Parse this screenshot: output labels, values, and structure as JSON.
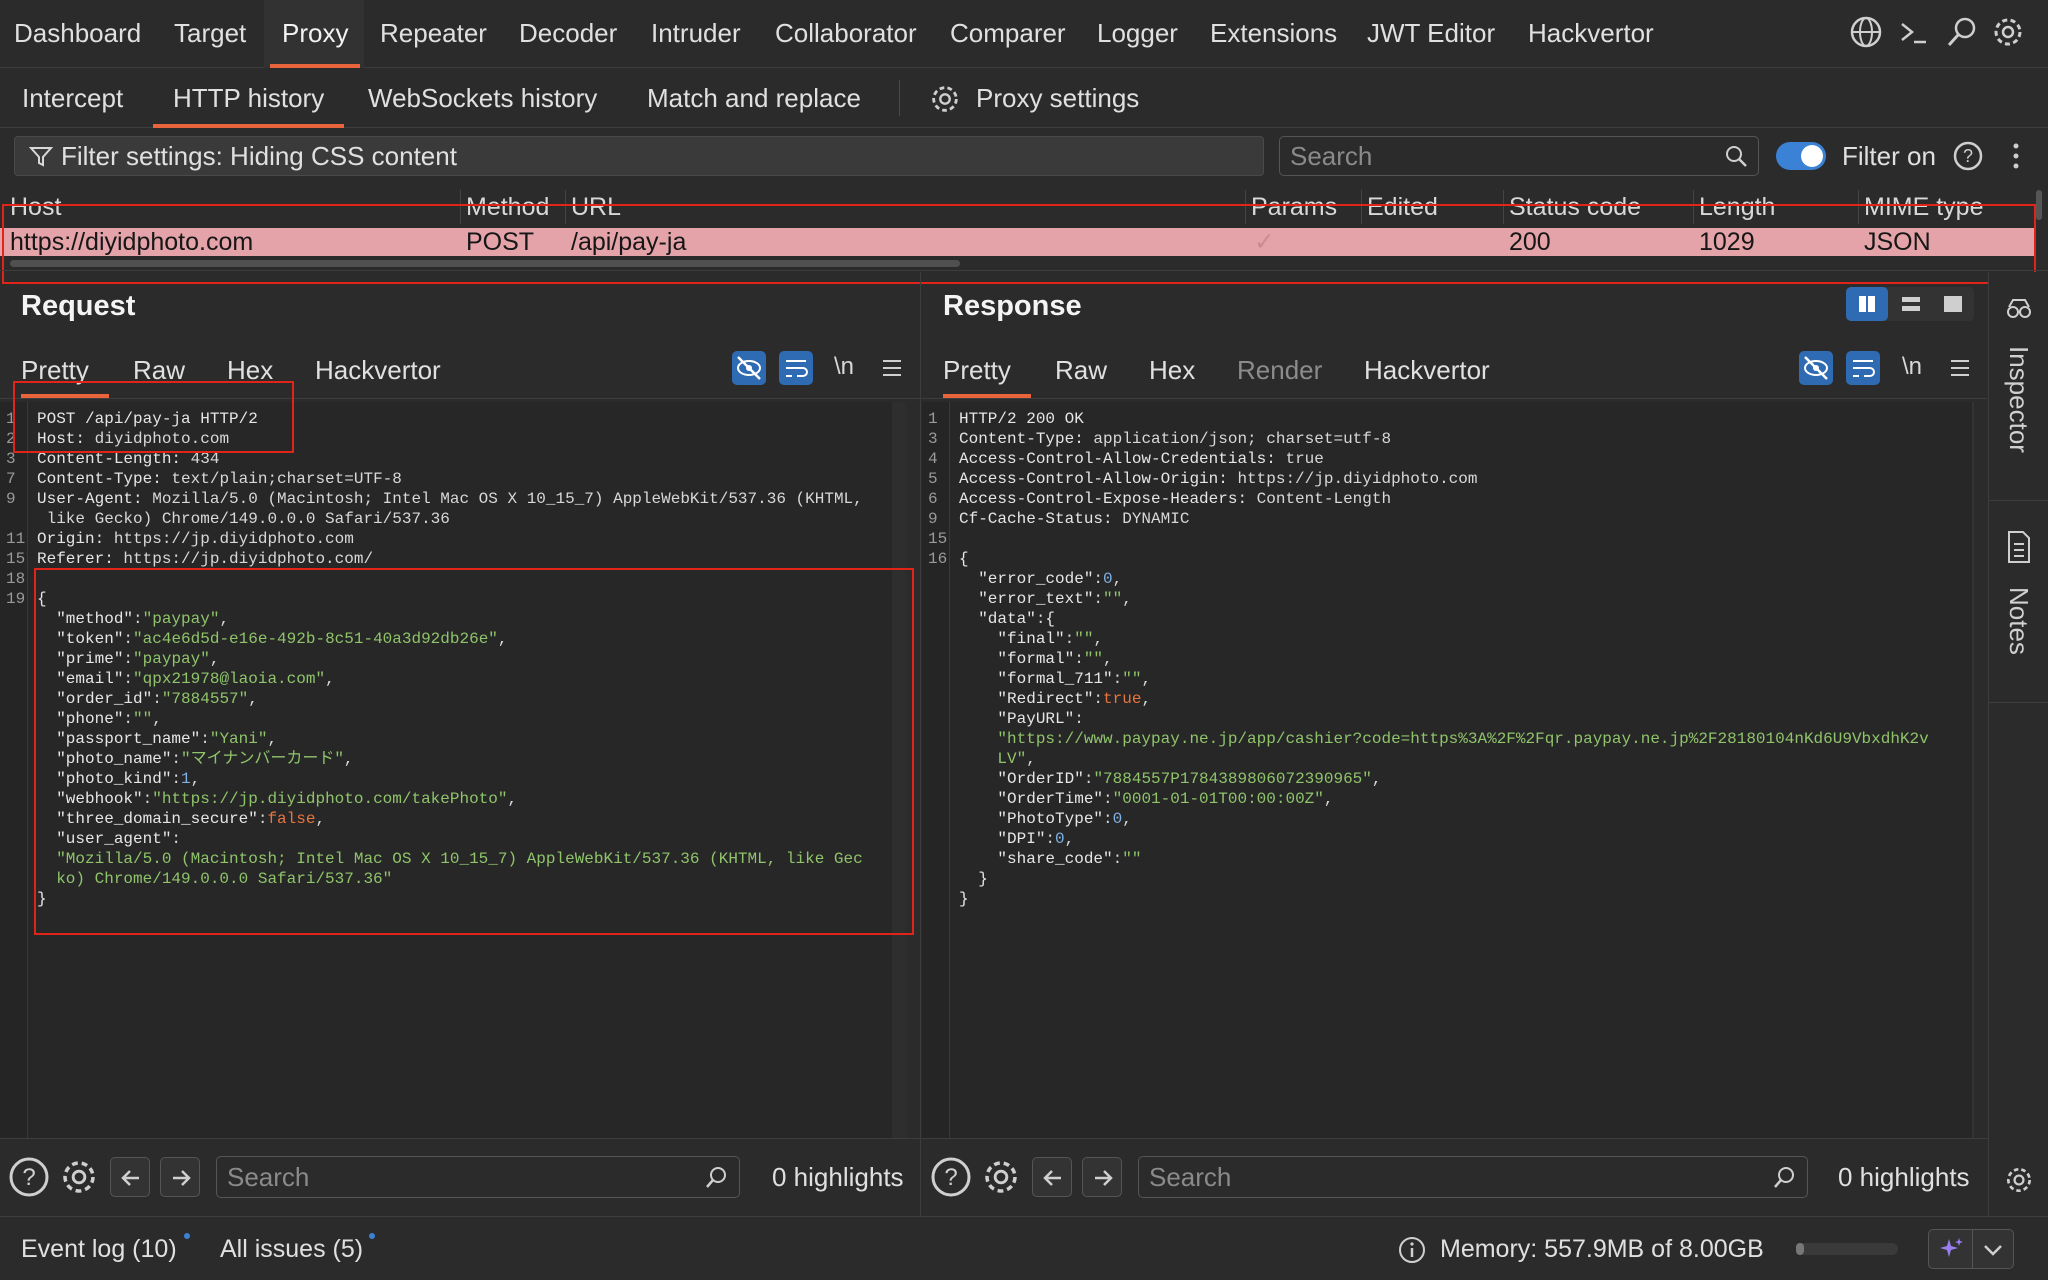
{
  "topnav": {
    "items": [
      "Dashboard",
      "Target",
      "Proxy",
      "Repeater",
      "Decoder",
      "Intruder",
      "Collaborator",
      "Comparer",
      "Logger",
      "Extensions",
      "JWT Editor",
      "Hackvertor"
    ],
    "active": "Proxy"
  },
  "subnav": {
    "items": [
      "Intercept",
      "HTTP history",
      "WebSockets history",
      "Match and replace"
    ],
    "settings_label": "Proxy settings"
  },
  "filter": {
    "label": "Filter settings: Hiding CSS content",
    "search_placeholder": "Search",
    "filter_on_label": "Filter on"
  },
  "table": {
    "headers": [
      "Host",
      "Method",
      "URL",
      "Params",
      "Edited",
      "Status code",
      "Length",
      "MIME type"
    ],
    "row": {
      "host": "https://diyidphoto.com",
      "method": "POST",
      "url": "/api/pay-ja",
      "params": "✓",
      "edited": "",
      "status": "200",
      "length": "1029",
      "mime": "JSON"
    }
  },
  "request": {
    "title": "Request",
    "tabs": [
      "Pretty",
      "Raw",
      "Hex",
      "Hackvertor"
    ],
    "newline_label": "\\n",
    "line_numbers": [
      "1",
      "2",
      "3",
      "7",
      "9",
      "",
      "11",
      "15",
      "18",
      "19",
      "",
      "",
      "",
      "",
      "",
      "",
      "",
      "",
      "",
      "",
      "",
      "",
      "",
      "",
      "",
      ""
    ],
    "headers": [
      [
        "POST /api/pay-ja HTTP/2",
        ""
      ],
      [
        "Host:",
        " diyidphoto.com"
      ],
      [
        "Content-Length:",
        " 434"
      ],
      [
        "Content-Type:",
        " text/plain;charset=UTF-8"
      ],
      [
        "User-Agent:",
        " Mozilla/5.0 (Macintosh; Intel Mac OS X 10_15_7) AppleWebKit/537.36 (KHTML,"
      ],
      [
        "",
        " like Gecko) Chrome/149.0.0.0 Safari/537.36"
      ],
      [
        "Origin:",
        " https://jp.diyidphoto.com"
      ],
      [
        "Referer:",
        " https://jp.diyidphoto.com/"
      ]
    ],
    "body": [
      {
        "k": "\"method\"",
        "v": "\"paypay\"",
        "t": "s"
      },
      {
        "k": "\"token\"",
        "v": "\"ac4e6d5d-e16e-492b-8c51-40a3d92db26e\"",
        "t": "s"
      },
      {
        "k": "\"prime\"",
        "v": "\"paypay\"",
        "t": "s"
      },
      {
        "k": "\"email\"",
        "v": "\"qpx21978@laoia.com\"",
        "t": "s"
      },
      {
        "k": "\"order_id\"",
        "v": "\"7884557\"",
        "t": "s"
      },
      {
        "k": "\"phone\"",
        "v": "\"\"",
        "t": "s"
      },
      {
        "k": "\"passport_name\"",
        "v": "\"Yani\"",
        "t": "s"
      },
      {
        "k": "\"photo_name\"",
        "v": "\"マイナンバーカード\"",
        "t": "s"
      },
      {
        "k": "\"photo_kind\"",
        "v": "1",
        "t": "n"
      },
      {
        "k": "\"webhook\"",
        "v": "\"https://jp.diyidphoto.com/takePhoto\"",
        "t": "s"
      },
      {
        "k": "\"three_domain_secure\"",
        "v": "false",
        "t": "b"
      },
      {
        "k": "\"user_agent\"",
        "v": "",
        "t": "s"
      }
    ],
    "ua_lines": [
      "\"Mozilla/5.0 (Macintosh; Intel Mac OS X 10_15_7) AppleWebKit/537.36 (KHTML, like Gec",
      "ko) Chrome/149.0.0.0 Safari/537.36\""
    ],
    "search_placeholder": "Search",
    "highlights": "0 highlights"
  },
  "response": {
    "title": "Response",
    "tabs": [
      "Pretty",
      "Raw",
      "Hex",
      "Render",
      "Hackvertor"
    ],
    "newline_label": "\\n",
    "line_numbers": [
      "1",
      "3",
      "4",
      "5",
      "6",
      "9",
      "15",
      "16"
    ],
    "headers": [
      [
        "HTTP/2 200 OK",
        ""
      ],
      [
        "Content-Type:",
        " application/json; charset=utf-8"
      ],
      [
        "Access-Control-Allow-Credentials:",
        " true"
      ],
      [
        "Access-Control-Allow-Origin:",
        " https://jp.diyidphoto.com"
      ],
      [
        "Access-Control-Expose-Headers:",
        " Content-Length"
      ],
      [
        "Cf-Cache-Status:",
        " DYNAMIC"
      ]
    ],
    "body": [
      {
        "indent": 1,
        "k": "\"error_code\"",
        "v": "0",
        "t": "n"
      },
      {
        "indent": 1,
        "k": "\"error_text\"",
        "v": "\"\"",
        "t": "s"
      },
      {
        "indent": 1,
        "k": "\"data\"",
        "v": "{",
        "t": "p"
      },
      {
        "indent": 2,
        "k": "\"final\"",
        "v": "\"\"",
        "t": "s"
      },
      {
        "indent": 2,
        "k": "\"formal\"",
        "v": "\"\"",
        "t": "s"
      },
      {
        "indent": 2,
        "k": "\"formal_711\"",
        "v": "\"\"",
        "t": "s"
      },
      {
        "indent": 2,
        "k": "\"Redirect\"",
        "v": "true",
        "t": "b"
      },
      {
        "indent": 2,
        "k": "\"PayURL\"",
        "v": "",
        "t": "p"
      }
    ],
    "payurl_lines": [
      "\"https://www.paypay.ne.jp/app/cashier?code=https%3A%2F%2Fqr.paypay.ne.jp%2F28180104nKd6U9VbxdhK2v",
      "LV\""
    ],
    "body2": [
      {
        "indent": 2,
        "k": "\"OrderID\"",
        "v": "\"7884557P1784389806072390965\"",
        "t": "s"
      },
      {
        "indent": 2,
        "k": "\"OrderTime\"",
        "v": "\"0001-01-01T00:00:00Z\"",
        "t": "s"
      },
      {
        "indent": 2,
        "k": "\"PhotoType\"",
        "v": "0",
        "t": "n"
      },
      {
        "indent": 2,
        "k": "\"DPI\"",
        "v": "0",
        "t": "n"
      },
      {
        "indent": 2,
        "k": "\"share_code\"",
        "v": "\"\"",
        "t": "s"
      }
    ],
    "search_placeholder": "Search",
    "highlights": "0 highlights"
  },
  "inspector": {
    "inspector_label": "Inspector",
    "notes_label": "Notes"
  },
  "status": {
    "event_log": "Event log (10)",
    "all_issues": "All issues (5)",
    "memory": "Memory: 557.9MB of 8.00GB"
  },
  "colors": {
    "accent": "#e8643d",
    "row_highlight": "#e3a3a8",
    "toggle": "#3b82d6",
    "annotation": "#e0241a"
  }
}
